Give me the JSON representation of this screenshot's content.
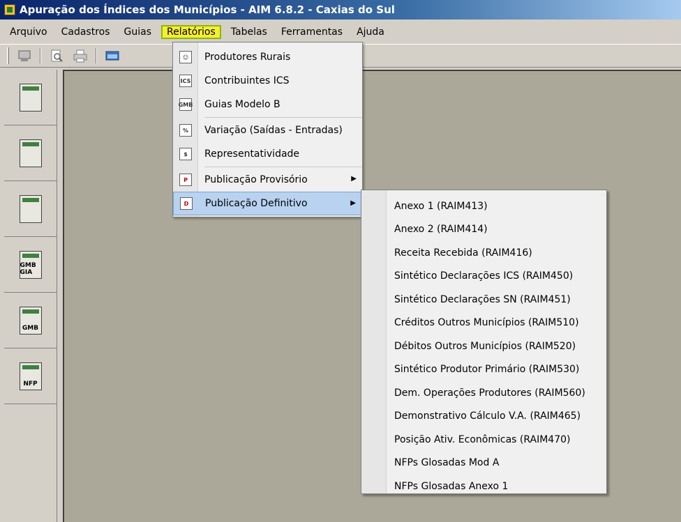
{
  "window": {
    "title": "Apuração dos Índices dos Municípios - AIM 6.8.2 - Caxias do Sul"
  },
  "menubar": [
    {
      "label": "Arquivo"
    },
    {
      "label": "Cadastros"
    },
    {
      "label": "Guias"
    },
    {
      "label": "Relatórios"
    },
    {
      "label": "Tabelas"
    },
    {
      "label": "Ferramentas"
    },
    {
      "label": "Ajuda"
    }
  ],
  "leftbar": [
    "",
    "",
    "",
    "GMB GIA",
    "GMB",
    "NFP"
  ],
  "relatorios_menu": {
    "items": [
      {
        "label": "Produtores Rurais",
        "icon": "farmer-icon"
      },
      {
        "label": "Contribuintes ICS",
        "icon": "ics-icon",
        "icon_text": "ICS"
      },
      {
        "label": "Guias Modelo B",
        "icon": "gmb-icon",
        "icon_text": "GMB"
      },
      {
        "label": "Variação (Saídas - Entradas)",
        "icon": "percent-icon",
        "icon_text": "%"
      },
      {
        "label": "Representatividade",
        "icon": "dollar-icon",
        "icon_text": "$"
      },
      {
        "label": "Publicação Provisório",
        "icon": "publication-icon",
        "icon_text": "P"
      },
      {
        "label": "Publicação Definitivo",
        "icon": "publication-def-icon",
        "icon_text": "D"
      }
    ]
  },
  "definitivo_submenu": [
    {
      "label": "Anexo 1 (RAIM413)"
    },
    {
      "label": "Anexo 2 (RAIM414)"
    },
    {
      "label": "Receita Recebida (RAIM416)"
    },
    {
      "label": "Sintético Declarações ICS (RAIM450)"
    },
    {
      "label": "Sintético Declarações SN (RAIM451)"
    },
    {
      "label": "Créditos Outros Municípios (RAIM510)"
    },
    {
      "label": "Débitos Outros Municípios (RAIM520)"
    },
    {
      "label": "Sintético Produtor Primário (RAIM530)"
    },
    {
      "label": "Dem. Operações Produtores (RAIM560)"
    },
    {
      "label": "Demonstrativo Cálculo V.A. (RAIM465)"
    },
    {
      "label": "Posição Ativ. Econômicas (RAIM470)"
    },
    {
      "label": "NFPs Glosadas Mod A"
    },
    {
      "label": "NFPs Glosadas Anexo 1"
    }
  ],
  "colors": {
    "highlight": "#f6ee33",
    "menu_hover": "#b8d2f0",
    "workspace": "#aca899"
  }
}
